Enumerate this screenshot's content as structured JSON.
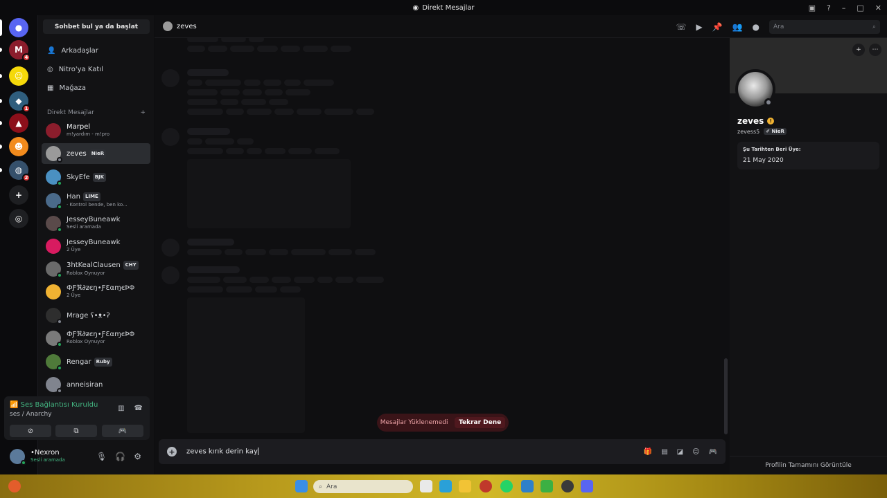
{
  "window": {
    "title": "Direkt Mesajlar",
    "title_icon": "discord-icon"
  },
  "guilds": {
    "items": [
      {
        "name": "discord-home",
        "glyph": "●",
        "color": "#5865f2",
        "badge": ""
      },
      {
        "name": "server-m",
        "glyph": "M",
        "color": "#8b1d2c",
        "badge": "4"
      },
      {
        "name": "server-smiley",
        "glyph": "☺",
        "color": "#f5d90a",
        "badge": ""
      },
      {
        "name": "server-blue",
        "glyph": "◆",
        "color": "#2f5e7d",
        "badge": "1"
      },
      {
        "name": "server-red",
        "glyph": "▲",
        "color": "#8c0f1a",
        "badge": ""
      },
      {
        "name": "server-orange",
        "glyph": "☻",
        "color": "#f28b1d",
        "badge": ""
      },
      {
        "name": "server-dark",
        "glyph": "◍",
        "color": "#35506b",
        "badge": "2"
      },
      {
        "name": "add-server",
        "glyph": "+",
        "color": "#1e1f22",
        "badge": ""
      },
      {
        "name": "explore",
        "glyph": "◎",
        "color": "#1e1f22",
        "badge": ""
      }
    ]
  },
  "dm": {
    "search_label": "Sohbet bul ya da başlat",
    "nav": [
      {
        "label": "Arkadaşlar",
        "icon": "friends-icon"
      },
      {
        "label": "Nitro'ya Katıl",
        "icon": "nitro-icon"
      },
      {
        "label": "Mağaza",
        "icon": "shop-icon"
      }
    ],
    "section_label": "Direkt Mesajlar",
    "section_add": "+",
    "items": [
      {
        "name": "Marpel",
        "sub": "m!yardım - m!pro",
        "tag": "",
        "color": "#8b1d2c",
        "status": "none",
        "bright": true
      },
      {
        "name": "zeves",
        "sub": "",
        "tag": "NieR",
        "color": "#9a9a9a",
        "status": "off",
        "bright": true
      },
      {
        "name": "SkyEfe",
        "sub": "",
        "tag": "BJK",
        "color": "#4a90c2",
        "status": "on",
        "bright": false
      },
      {
        "name": "Han",
        "sub": "· Kontrol bende, ben ko...",
        "tag": "LIME",
        "color": "#4a6a8a",
        "status": "on",
        "bright": false
      },
      {
        "name": "JesseyBuneawk",
        "sub": "Sesli aramada",
        "tag": "",
        "color": "#5a4a4a",
        "status": "on",
        "bright": false
      },
      {
        "name": "JesseyBuneawk",
        "sub": "2 Üye",
        "tag": "",
        "color": "#d81b60",
        "status": "none",
        "bright": false
      },
      {
        "name": "3htKealClausen",
        "sub": "Roblox Oynuyor",
        "tag": "CHY",
        "color": "#6a6a6a",
        "status": "on",
        "bright": false
      },
      {
        "name": "ФƑℜ∂ƶєŋ•ƑƐαɱєÞΦ",
        "sub": "2 Üye",
        "tag": "",
        "color": "#f0b232",
        "status": "none",
        "bright": false
      },
      {
        "name": "Mrage ʕ•ᴥ•ʔ",
        "sub": "",
        "tag": "",
        "color": "#2e2e2e",
        "status": "off",
        "bright": false
      },
      {
        "name": "ФƑℜ∂ƶєŋ•ƑƐαɱєÞΦ",
        "sub": "Roblox Oynuyor",
        "tag": "",
        "color": "#7a7a7a",
        "status": "on",
        "bright": false
      },
      {
        "name": "Rengar",
        "sub": "",
        "tag": "Ruby",
        "color": "#4f7a3a",
        "status": "on",
        "bright": false
      },
      {
        "name": "anneisiran",
        "sub": "",
        "tag": "",
        "color": "#80848e",
        "status": "off",
        "bright": false
      }
    ]
  },
  "voice": {
    "status": "Ses Bağlantısı Kuruldu",
    "channel": "ses / Anarchy"
  },
  "user": {
    "name": "•Nexron",
    "status": "Sesli aramada"
  },
  "chat": {
    "recipient": "zeves",
    "search_placeholder": "Ara",
    "error_text": "Mesajlar Yüklenemedi",
    "retry_label": "Tekrar Dene",
    "composer_text": "zeves kırık derin kay"
  },
  "profile": {
    "display_name": "zeves",
    "username": "zevess5",
    "tag": "NieR",
    "member_since_label": "Şu Tarihten Beri Üye:",
    "member_since_value": "21 May 2020",
    "footer_link": "Profilin Tamamını Görüntüle"
  },
  "taskbar": {
    "search_placeholder": "Ara"
  },
  "colors": {
    "accent": "#5865f2",
    "online": "#23a55a",
    "offline": "#80848e",
    "voice_green": "#43b581",
    "error_bg": "#3a1418"
  }
}
